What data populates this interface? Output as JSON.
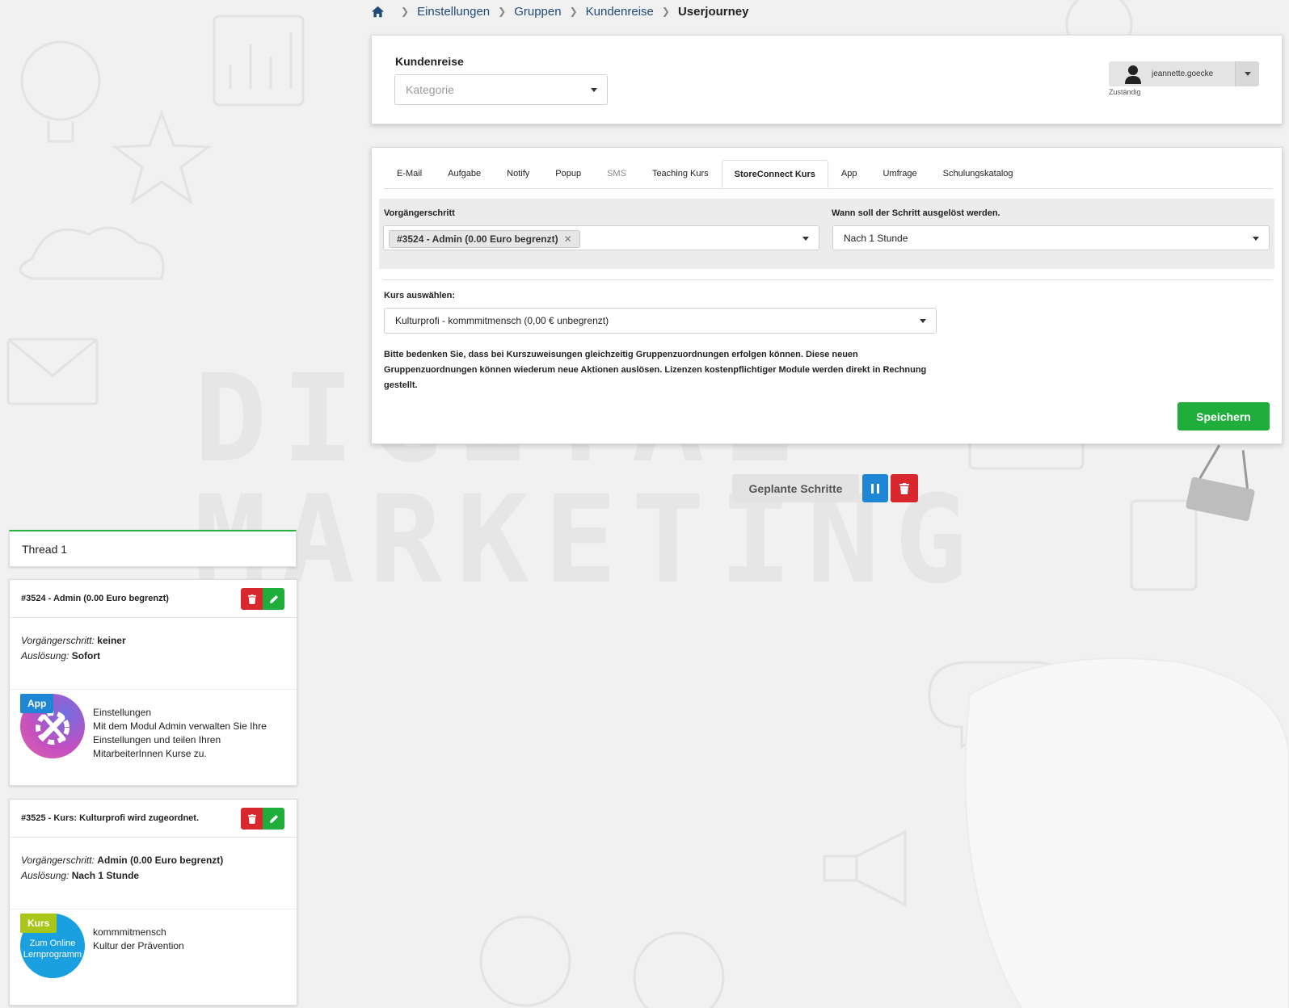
{
  "breadcrumb": {
    "items": [
      "Einstellungen",
      "Gruppen",
      "Kundenreise"
    ],
    "current": "Userjourney"
  },
  "top_card": {
    "title": "Kundenreise",
    "category_placeholder": "Kategorie",
    "user_name": "jeannette.goecke",
    "user_caption": "Zuständig"
  },
  "tabs": [
    {
      "label": "E-Mail",
      "state": "normal"
    },
    {
      "label": "Aufgabe",
      "state": "normal"
    },
    {
      "label": "Notify",
      "state": "normal"
    },
    {
      "label": "Popup",
      "state": "normal"
    },
    {
      "label": "SMS",
      "state": "disabled"
    },
    {
      "label": "Teaching Kurs",
      "state": "normal"
    },
    {
      "label": "StoreConnect Kurs",
      "state": "active"
    },
    {
      "label": "App",
      "state": "normal"
    },
    {
      "label": "Umfrage",
      "state": "normal"
    },
    {
      "label": "Schulungskatalog",
      "state": "normal"
    }
  ],
  "form": {
    "predecessor_label": "Vorgängerschritt",
    "predecessor_chip": "#3524 - Admin (0.00 Euro begrenzt)",
    "trigger_label": "Wann soll der Schritt ausgelöst werden.",
    "trigger_value": "Nach 1 Stunde",
    "course_label": "Kurs auswählen:",
    "course_value": "Kulturprofi - kommmitmensch (0,00 € unbegrenzt)",
    "notice": "Bitte bedenken Sie, dass bei Kurszuweisungen gleichzeitig Gruppenzuordnungen erfolgen können. Diese neuen Gruppenzuordnungen können wiederum neue Aktionen auslösen. Lizenzen kostenpflichtiger Module werden direkt in Rechnung gestellt.",
    "save_label": "Speichern"
  },
  "planned": {
    "label": "Geplante Schritte"
  },
  "thread": {
    "title": "Thread 1"
  },
  "steps": [
    {
      "title": "#3524 - Admin (0.00 Euro begrenzt)",
      "predecessor_key": "Vorgängerschritt:",
      "predecessor_value": "keiner",
      "trigger_key": "Auslösung:",
      "trigger_value": "Sofort",
      "badge": "App",
      "desc_title": "Einstellungen",
      "desc_text": "Mit dem Modul Admin verwalten Sie Ihre Einstellungen und teilen Ihren MitarbeiterInnen Kurse zu."
    },
    {
      "title": "#3525 - Kurs: Kulturprofi wird zugeordnet.",
      "predecessor_key": "Vorgängerschritt:",
      "predecessor_value": "Admin (0.00 Euro begrenzt)",
      "trigger_key": "Auslösung:",
      "trigger_value": "Nach 1 Stunde",
      "badge": "Kurs",
      "thumb_text": "Zum Online Lernprogramm",
      "desc_title": "kommmitmensch",
      "desc_text": "Kultur der Prävention"
    }
  ],
  "background": {
    "word1": "DIGITAL",
    "word2": "MARKETING"
  },
  "colors": {
    "green": "#1fae3c",
    "red": "#d9272e",
    "blue": "#1f86d6",
    "link": "#1f4a78",
    "kurs_badge": "#a8c71a",
    "app_badge": "#1f86d6"
  }
}
